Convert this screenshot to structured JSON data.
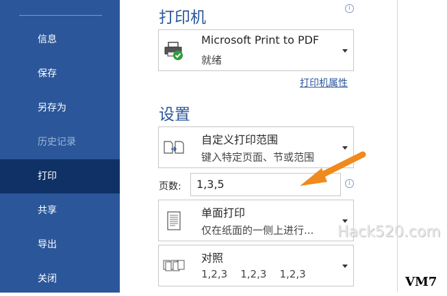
{
  "sidebar": {
    "items": [
      {
        "label": "信息"
      },
      {
        "label": "保存"
      },
      {
        "label": "另存为"
      },
      {
        "label": "历史记录"
      },
      {
        "label": "打印"
      },
      {
        "label": "共享"
      },
      {
        "label": "导出"
      },
      {
        "label": "关闭"
      }
    ]
  },
  "printer": {
    "title": "打印机",
    "name": "Microsoft Print to PDF",
    "status": "就绪",
    "properties_link": "打印机属性"
  },
  "settings": {
    "title": "设置",
    "range": {
      "label": "自定义打印范围",
      "sub": "键入特定页面、节或范围"
    },
    "pages_label": "页数:",
    "pages_value": "1,3,5",
    "sides": {
      "label": "单面打印",
      "sub": "仅在纸面的一侧上进行..."
    },
    "collate": {
      "label": "对照",
      "sub": "1,2,3    1,2,3    1,2,3"
    }
  },
  "watermark": "Hack520.com",
  "corner_label": "VM7",
  "colors": {
    "sidebar": "#2b579a",
    "sidebar_active": "#0f3166",
    "accent": "#2b579a",
    "arrow": "#f08a1c"
  }
}
